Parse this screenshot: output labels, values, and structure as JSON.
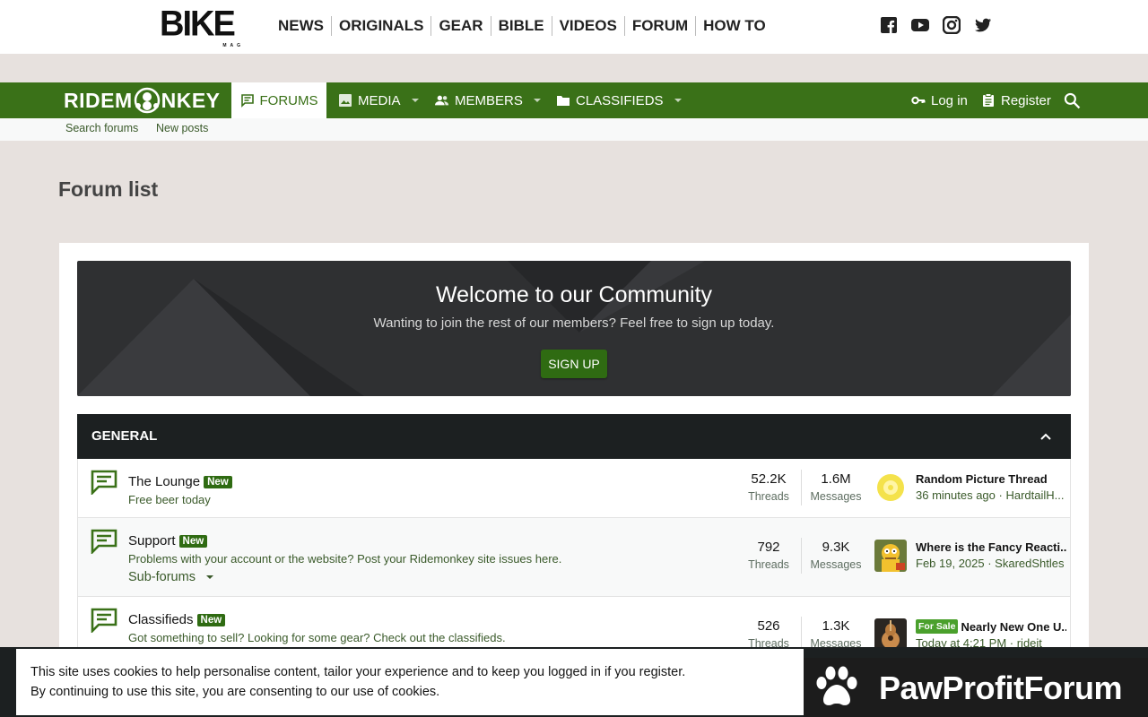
{
  "bike": {
    "logo": "BIKE",
    "logo_sub": "MAG",
    "nav": [
      "NEWS",
      "ORIGINALS",
      "GEAR",
      "BIBLE",
      "VIDEOS",
      "FORUM",
      "HOW TO"
    ]
  },
  "rm": {
    "logo_left": "RIDEM",
    "logo_right": "NKEY",
    "tabs": {
      "forums": "FORUMS",
      "media": "MEDIA",
      "members": "MEMBERS",
      "classifieds": "CLASSIFIEDS"
    },
    "login": "Log in",
    "register": "Register",
    "subnav": [
      "Search forums",
      "New posts"
    ]
  },
  "page_title": "Forum list",
  "welcome": {
    "title": "Welcome to our Community",
    "text": "Wanting to join the rest of our members? Feel free to sign up today.",
    "button": "SIGN UP"
  },
  "category": {
    "title": "GENERAL"
  },
  "nodes": [
    {
      "title": "The Lounge",
      "badge": "New",
      "desc": "Free beer today",
      "threads": "52.2K",
      "messages": "1.6M",
      "threads_label": "Threads",
      "messages_label": "Messages",
      "last_title": "Random Picture Thread",
      "last_meta": "36 minutes ago · HardtailH..."
    },
    {
      "title": "Support",
      "badge": "New",
      "desc": "Problems with your account or the website? Post your Ridemonkey site issues here.",
      "subforums": "Sub-forums",
      "threads": "792",
      "messages": "9.3K",
      "threads_label": "Threads",
      "messages_label": "Messages",
      "last_title": "Where is the Fancy Reacti...",
      "last_meta": "Feb 19, 2025 · SkaredShtles"
    },
    {
      "title": "Classifieds",
      "badge": "New",
      "desc": "Got something to sell? Looking for some gear? Check out the classifieds.",
      "threads": "526",
      "messages": "1.3K",
      "threads_label": "Threads",
      "messages_label": "Messages",
      "prefix": "For Sale",
      "last_title": "Nearly New One U...",
      "last_meta": "Today at 4:21 PM · rideit"
    }
  ],
  "cookie": {
    "line1": "This site uses cookies to help personalise content, tailor your experience and to keep you logged in if you register.",
    "line2": "By continuing to use this site, you are consenting to our use of cookies."
  },
  "watermark": {
    "text": "PawProfitForum"
  },
  "colors": {
    "green": "#3a7118",
    "dark": "#1c2021",
    "badge": "#2f6b12"
  }
}
